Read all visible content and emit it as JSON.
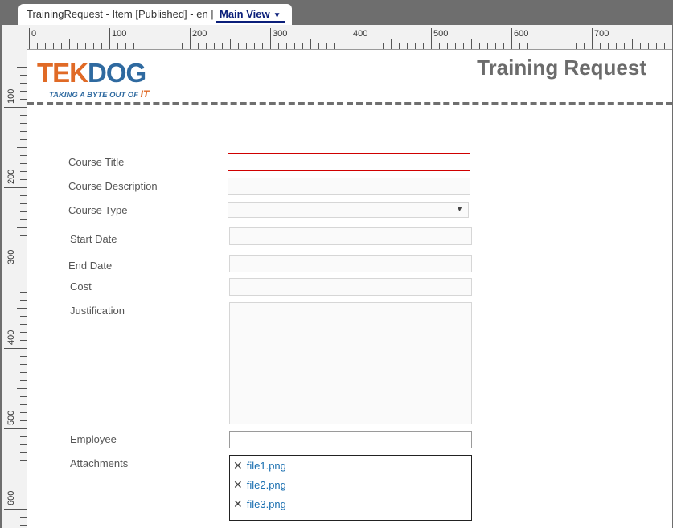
{
  "tab": {
    "title": "TrainingRequest - Item [Published] - en |",
    "view_label": "Main View",
    "view_arrow": "▼"
  },
  "ruler": {
    "horizontal_labels": [
      "0",
      "100",
      "200",
      "300",
      "400",
      "500",
      "600",
      "700"
    ],
    "vertical_labels": [
      "100",
      "200",
      "300",
      "400",
      "500",
      "600"
    ]
  },
  "header": {
    "logo_brand_part1": "TEK",
    "logo_brand_part2": "DOG",
    "logo_tagline": "TAKING A BYTE OUT OF",
    "logo_tagline_accent": "IT",
    "title": "Training Request"
  },
  "form": {
    "course_title_label": "Course Title",
    "course_description_label": "Course Description",
    "course_type_label": "Course Type",
    "course_type_arrow": "▼",
    "start_date_label": "Start Date",
    "end_date_label": "End Date",
    "cost_label": "Cost",
    "justification_label": "Justification",
    "employee_label": "Employee",
    "attachments_label": "Attachments",
    "attachments": [
      "file1.png",
      "file2.png",
      "file3.png"
    ],
    "remove_glyph": "✕"
  },
  "colors": {
    "logo_orange": "#e06a26",
    "logo_blue": "#2f6aa0",
    "required_border": "#d00000",
    "link": "#1a6fb0"
  }
}
